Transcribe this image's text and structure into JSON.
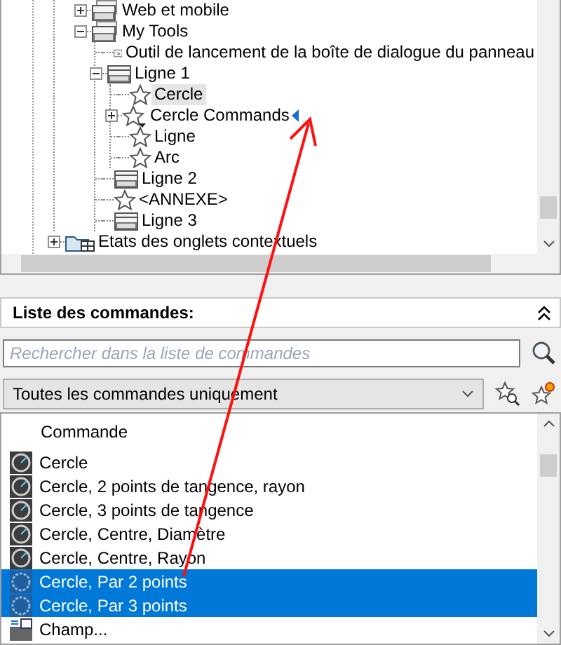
{
  "tree": {
    "continued": [
      {
        "label": "Web et mobile",
        "kind": "panel",
        "expanded": false,
        "selected": false
      },
      {
        "label": "My Tools",
        "kind": "panel",
        "expanded": true,
        "selected": false,
        "children": [
          {
            "label": "Outil de lancement de la boîte de dialogue du panneau",
            "kind": "launcher",
            "selected": false
          },
          {
            "label": "Ligne 1",
            "kind": "row",
            "expanded": true,
            "selected": false,
            "children": [
              {
                "label": "Cercle",
                "kind": "command",
                "selected": true
              },
              {
                "label": "Cercle Commands",
                "kind": "split",
                "expanded": false,
                "selected": false,
                "drop_marker": true
              },
              {
                "label": "Ligne",
                "kind": "command",
                "selected": false
              },
              {
                "label": "Arc",
                "kind": "command",
                "selected": false
              }
            ]
          },
          {
            "label": "Ligne 2",
            "kind": "row",
            "selected": false
          },
          {
            "label": "<ANNEXE>",
            "kind": "command",
            "selected": false
          },
          {
            "label": "Ligne 3",
            "kind": "row",
            "selected": false
          }
        ]
      }
    ],
    "items": [
      {
        "label": "Etats des onglets contextuels",
        "kind": "folder",
        "expanded": false,
        "selected": false
      }
    ]
  },
  "command_list": {
    "title": "Liste des commandes:",
    "search": {
      "placeholder": "Rechercher dans la liste de commandes"
    },
    "filter": {
      "value": "Toutes les commandes uniquement"
    },
    "column": "Commande",
    "rows": [
      {
        "label": "Cercle",
        "kind": "circle",
        "selected": false
      },
      {
        "label": "Cercle, 2 points de tangence, rayon",
        "kind": "circle",
        "selected": false
      },
      {
        "label": "Cercle, 3 points de tangence",
        "kind": "circle",
        "selected": false
      },
      {
        "label": "Cercle, Centre, Diamètre",
        "kind": "circle",
        "selected": false
      },
      {
        "label": "Cercle, Centre, Rayon",
        "kind": "circle",
        "selected": false
      },
      {
        "label": "Cercle, Par 2 points",
        "kind": "circle",
        "selected": true
      },
      {
        "label": "Cercle, Par 3 points",
        "kind": "circle",
        "selected": true
      },
      {
        "label": "Champ...",
        "kind": "field",
        "selected": false
      }
    ]
  }
}
